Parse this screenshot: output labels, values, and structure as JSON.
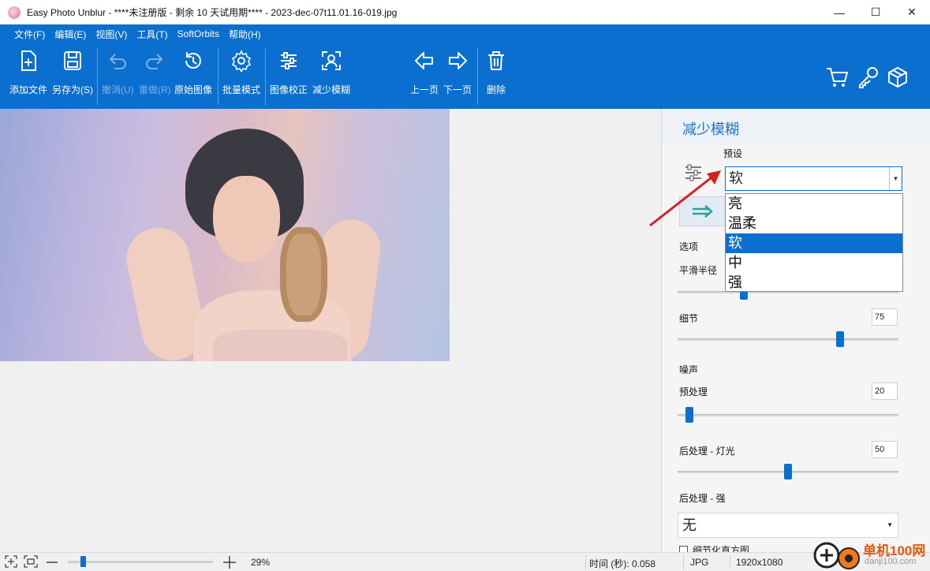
{
  "window": {
    "title": "Easy Photo Unblur - ****未注册版 - 剩余 10 天试用期**** - 2023-dec-07t11.01.16-019.jpg",
    "minimize": "—",
    "maximize": "☐",
    "close": "✕"
  },
  "menu": [
    "文件(F)",
    "编辑(E)",
    "视图(V)",
    "工具(T)",
    "SoftOrbits",
    "帮助(H)"
  ],
  "toolbar": {
    "add_file": "添加文件",
    "save_as": "另存为(S)",
    "undo": "撤消(U)",
    "redo": "重做(R)",
    "original": "原始图像",
    "batch": "批量模式",
    "correction": "图像校正",
    "unblur": "减少模糊",
    "prev": "上一页",
    "next": "下一页",
    "delete": "删除"
  },
  "panel": {
    "title": "减少模糊",
    "preset_label": "预设",
    "preset_value": "软",
    "preset_options": [
      "亮",
      "温柔",
      "软",
      "中",
      "强"
    ],
    "preset_selected_index": 2,
    "options_label": "选项",
    "smooth_radius_label": "平滑半径",
    "detail_label": "细节",
    "detail_value": "75",
    "noise_label": "噪声",
    "preprocess_label": "预处理",
    "preprocess_value": "20",
    "post_light_label": "后处理 - 灯光",
    "post_light_value": "50",
    "post_strong_label": "后处理 - 强",
    "post_strong_value": "无",
    "checkbox_label": "细节化直方图"
  },
  "statusbar": {
    "zoom": "29%",
    "time": "时间 (秒): 0.058",
    "format": "JPG",
    "dimensions": "1920x1080"
  },
  "watermark": {
    "text": "单机100网",
    "sub": "danji100.com"
  },
  "colors": {
    "accent": "#0a6fcf",
    "arrow": "#d42020"
  }
}
